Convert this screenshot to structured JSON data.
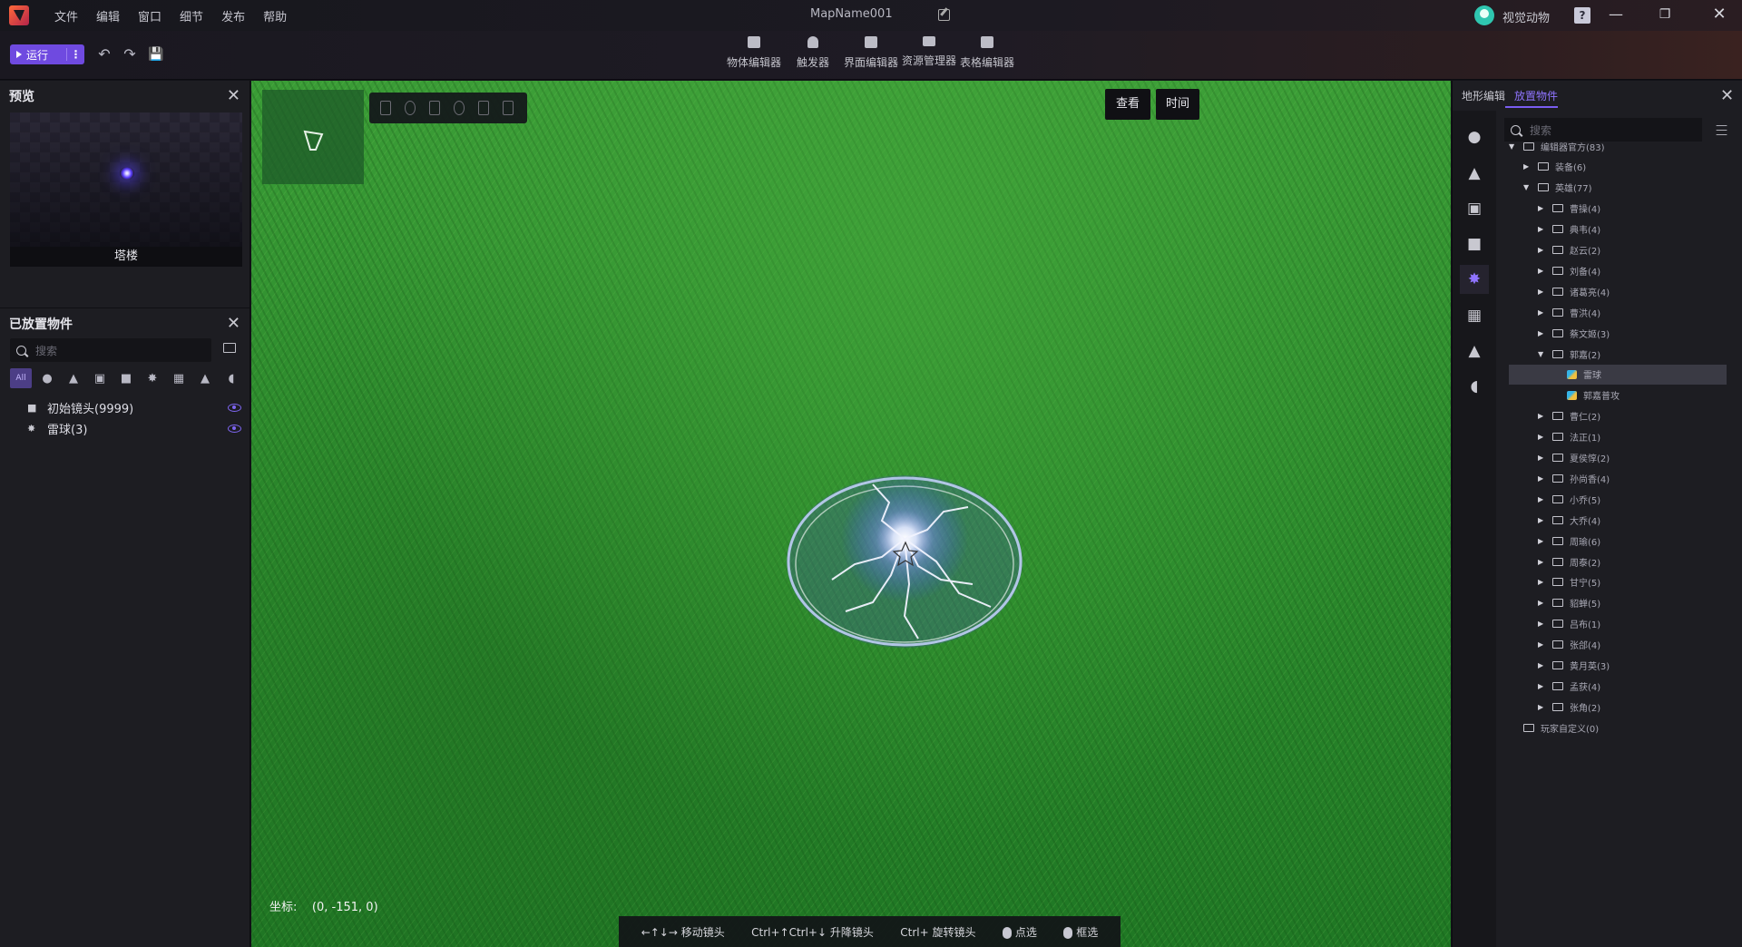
{
  "titlebar": {
    "menus": [
      "文件",
      "编辑",
      "窗口",
      "细节",
      "发布",
      "帮助"
    ],
    "map_name": "MapName001",
    "user_name": "视觉动物"
  },
  "toolbar": {
    "run_label": "运行",
    "editors": [
      "物体编辑器",
      "触发器",
      "界面编辑器",
      "资源管理器",
      "表格编辑器"
    ]
  },
  "preview": {
    "title": "预览",
    "caption": "塔楼"
  },
  "placed": {
    "title": "已放置物件",
    "search_placeholder": "搜索",
    "filter_all": "All",
    "items": [
      {
        "label": "初始镜头(9999)"
      },
      {
        "label": "雷球(3)"
      }
    ]
  },
  "viewport": {
    "buttons": [
      "查看",
      "时间"
    ],
    "coord_label": "坐标:",
    "coord_value": "(0, -151, 0)",
    "hints": [
      "←↑↓→ 移动镜头",
      "Ctrl+↑Ctrl+↓ 升降镜头",
      "Ctrl+ 旋转镜头",
      "点选",
      "框选"
    ]
  },
  "right_panel": {
    "tabs": [
      "地形编辑",
      "放置物件"
    ],
    "active_tab": "放置物件",
    "search_placeholder": "搜索",
    "tree": [
      {
        "label": "编辑器官方(83)",
        "level": 0,
        "arrow": "down",
        "kind": "folder"
      },
      {
        "label": "装备(6)",
        "level": 1,
        "arrow": "right",
        "kind": "folder"
      },
      {
        "label": "英雄(77)",
        "level": 1,
        "arrow": "down",
        "kind": "folder"
      },
      {
        "label": "曹操(4)",
        "level": 2,
        "arrow": "right",
        "kind": "folder"
      },
      {
        "label": "典韦(4)",
        "level": 2,
        "arrow": "right",
        "kind": "folder"
      },
      {
        "label": "赵云(2)",
        "level": 2,
        "arrow": "right",
        "kind": "folder"
      },
      {
        "label": "刘备(4)",
        "level": 2,
        "arrow": "right",
        "kind": "folder"
      },
      {
        "label": "诸葛亮(4)",
        "level": 2,
        "arrow": "right",
        "kind": "folder"
      },
      {
        "label": "曹洪(4)",
        "level": 2,
        "arrow": "right",
        "kind": "folder"
      },
      {
        "label": "蔡文姬(3)",
        "level": 2,
        "arrow": "right",
        "kind": "folder"
      },
      {
        "label": "郭嘉(2)",
        "level": 2,
        "arrow": "down",
        "kind": "folder"
      },
      {
        "label": "雷球",
        "level": 3,
        "arrow": "",
        "kind": "effect",
        "selected": true
      },
      {
        "label": "郭嘉普攻",
        "level": 3,
        "arrow": "",
        "kind": "effect"
      },
      {
        "label": "曹仁(2)",
        "level": 2,
        "arrow": "right",
        "kind": "folder"
      },
      {
        "label": "法正(1)",
        "level": 2,
        "arrow": "right",
        "kind": "folder"
      },
      {
        "label": "夏侯惇(2)",
        "level": 2,
        "arrow": "right",
        "kind": "folder"
      },
      {
        "label": "孙尚香(4)",
        "level": 2,
        "arrow": "right",
        "kind": "folder"
      },
      {
        "label": "小乔(5)",
        "level": 2,
        "arrow": "right",
        "kind": "folder"
      },
      {
        "label": "大乔(4)",
        "level": 2,
        "arrow": "right",
        "kind": "folder"
      },
      {
        "label": "周瑜(6)",
        "level": 2,
        "arrow": "right",
        "kind": "folder"
      },
      {
        "label": "周泰(2)",
        "level": 2,
        "arrow": "right",
        "kind": "folder"
      },
      {
        "label": "甘宁(5)",
        "level": 2,
        "arrow": "right",
        "kind": "folder"
      },
      {
        "label": "貂蝉(5)",
        "level": 2,
        "arrow": "right",
        "kind": "folder"
      },
      {
        "label": "吕布(1)",
        "level": 2,
        "arrow": "right",
        "kind": "folder"
      },
      {
        "label": "张郃(4)",
        "level": 2,
        "arrow": "right",
        "kind": "folder"
      },
      {
        "label": "黄月英(3)",
        "level": 2,
        "arrow": "right",
        "kind": "folder"
      },
      {
        "label": "孟获(4)",
        "level": 2,
        "arrow": "right",
        "kind": "folder"
      },
      {
        "label": "张角(2)",
        "level": 2,
        "arrow": "right",
        "kind": "folder"
      },
      {
        "label": "玩家自定义(0)",
        "level": 0,
        "arrow": "",
        "kind": "folder"
      }
    ]
  },
  "colors": {
    "accent": "#7a5cf0",
    "run_button": "#6f4ae0",
    "grass": "#2a8a2a"
  }
}
